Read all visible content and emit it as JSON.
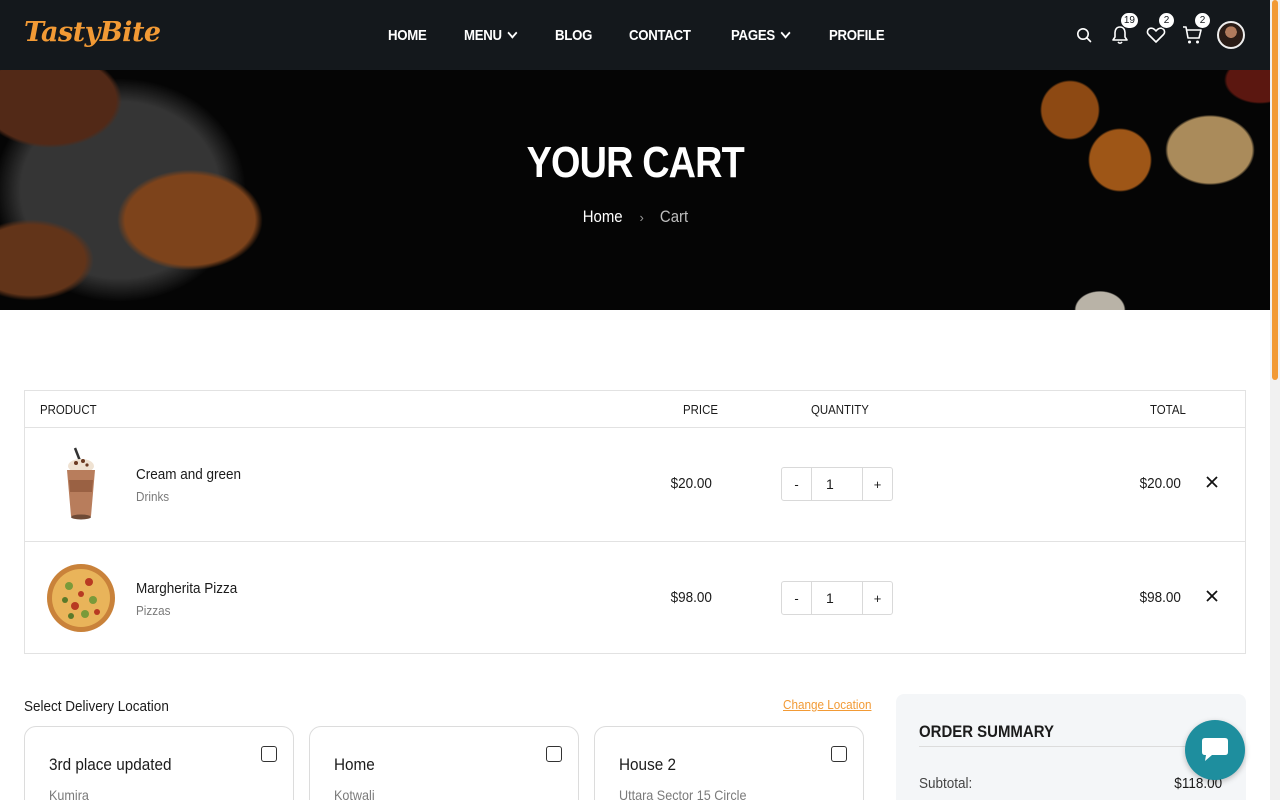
{
  "brand": {
    "logo": "TastyBite",
    "accent": "#f29a35"
  },
  "nav": {
    "items": [
      {
        "label": "HOME",
        "dropdown": false
      },
      {
        "label": "MENU",
        "dropdown": true
      },
      {
        "label": "BLOG",
        "dropdown": false
      },
      {
        "label": "CONTACT",
        "dropdown": false
      },
      {
        "label": "PAGES",
        "dropdown": true
      },
      {
        "label": "PROFILE",
        "dropdown": false
      }
    ]
  },
  "header_icons": {
    "notifications_count": "19",
    "wishlist_count": "2",
    "cart_count": "2"
  },
  "hero": {
    "title": "YOUR CART",
    "breadcrumb_home": "Home",
    "breadcrumb_current": "Cart"
  },
  "cart": {
    "headers": {
      "product": "PRODUCT",
      "price": "PRICE",
      "quantity": "QUANTITY",
      "total": "TOTAL"
    },
    "items": [
      {
        "name": "Cream and green",
        "category": "Drinks",
        "price": "$20.00",
        "quantity": "1",
        "total": "$20.00",
        "image": "milkshake"
      },
      {
        "name": "Margherita Pizza",
        "category": "Pizzas",
        "price": "$98.00",
        "quantity": "1",
        "total": "$98.00",
        "image": "pizza"
      }
    ],
    "minus_label": "-",
    "plus_label": "+"
  },
  "delivery": {
    "title": "Select Delivery Location",
    "change_label": "Change Location",
    "locations": [
      {
        "name": "3rd place updated",
        "address": "Kumira"
      },
      {
        "name": "Home",
        "address": "Kotwali"
      },
      {
        "name": "House 2",
        "address": "Uttara Sector 15 Circle"
      }
    ]
  },
  "summary": {
    "title": "ORDER SUMMARY",
    "subtotal_label": "Subtotal:",
    "subtotal_value": "$118.00"
  },
  "chat": {
    "color": "#1e8e9e"
  }
}
